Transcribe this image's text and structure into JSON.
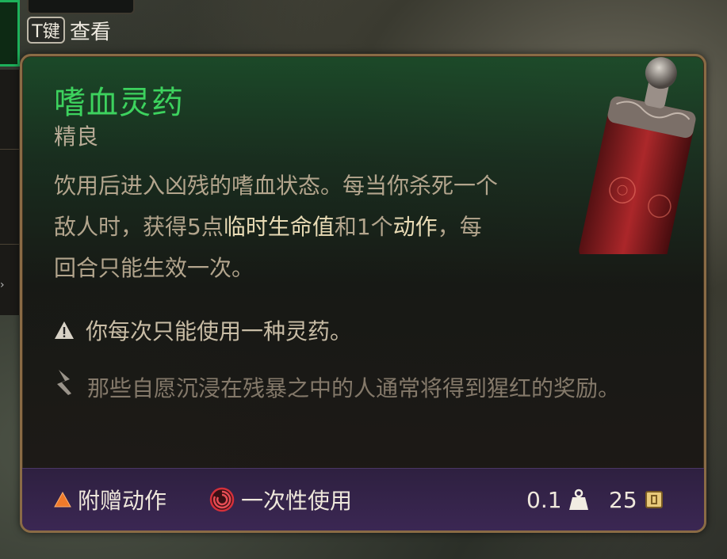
{
  "hint": {
    "key": "T键",
    "label": "查看"
  },
  "item": {
    "name": "嗜血灵药",
    "rarity": "精良",
    "description": {
      "part1": "饮用后进入凶残的嗜血状态。每当你杀死一个敌人时，获得5点",
      "hl1": "临时生命值",
      "part2": "和1个",
      "hl2": "动作",
      "part3": "，每回合只能生效一次。"
    },
    "warning": "你每次只能使用一种灵药。",
    "flavor": "那些自愿沉浸在残暴之中的人通常将得到猩红的奖励。"
  },
  "footer": {
    "action_type": "附赠动作",
    "usage": "一次性使用",
    "weight": "0.1",
    "value": "25"
  },
  "icons": {
    "warning": "warning-icon",
    "flavor": "quill-icon",
    "action": "bonus-action-triangle-icon",
    "usage": "single-use-swirl-icon",
    "weight": "weight-icon",
    "value": "gold-coin-icon"
  },
  "colors": {
    "title": "#3dd25e",
    "border": "#8a6b45",
    "footer": "#3b2753",
    "highlight": "#e9dbb5"
  }
}
